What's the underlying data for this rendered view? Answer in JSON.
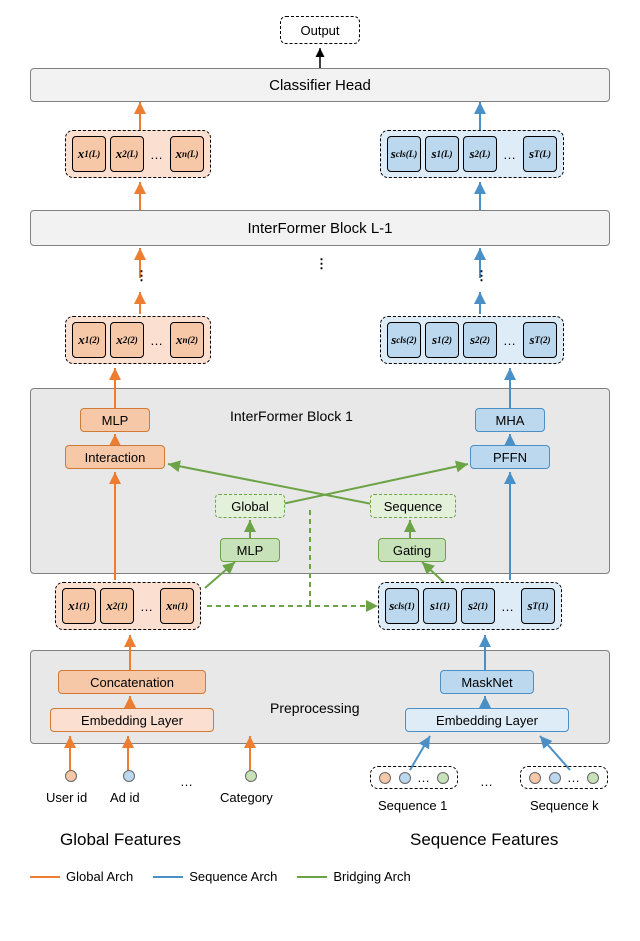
{
  "top": {
    "output": "Output",
    "classifier": "Classifier Head"
  },
  "blocks": {
    "interformer_lm1": "InterFormer Block L-1",
    "interformer_1_label": "InterFormer Block 1"
  },
  "global_side": {
    "mlp": "MLP",
    "interaction": "Interaction",
    "concat": "Concatenation",
    "embed": "Embedding Layer"
  },
  "seq_side": {
    "mha": "MHA",
    "pffn": "PFFN",
    "masknet": "MaskNet",
    "embed": "Embedding Layer"
  },
  "bridge": {
    "global": "Global",
    "sequence": "Sequence",
    "mlp": "MLP",
    "gating": "Gating"
  },
  "preproc_label": "Preprocessing",
  "tokens": {
    "x": {
      "L": [
        "x₁",
        "x₂",
        "…",
        "xₙ"
      ],
      "2": [
        "x₁",
        "x₂",
        "…",
        "xₙ"
      ],
      "1": [
        "x₁",
        "x₂",
        "…",
        "xₙ"
      ]
    },
    "s": {
      "L": [
        "s꜀ₗₛ",
        "s₁",
        "s₂",
        "…",
        "sₜ"
      ],
      "2": [
        "s꜀ₗₛ",
        "s₁",
        "s₂",
        "…",
        "sₜ"
      ],
      "1": [
        "s꜀ₗₛ",
        "s₁",
        "s₂",
        "…",
        "sₜ"
      ]
    }
  },
  "inputs": {
    "global": [
      "User id",
      "Ad id",
      "…",
      "Category"
    ],
    "seq": [
      "Sequence 1",
      "…",
      "Sequence k"
    ]
  },
  "footer": {
    "global": "Global Features",
    "seq": "Sequence Features"
  },
  "legend": {
    "g": "Global Arch",
    "s": "Sequence Arch",
    "b": "Bridging Arch"
  },
  "colors": {
    "orange": "#ec7d31",
    "blue": "#4a90c7",
    "green": "#6ba346"
  }
}
